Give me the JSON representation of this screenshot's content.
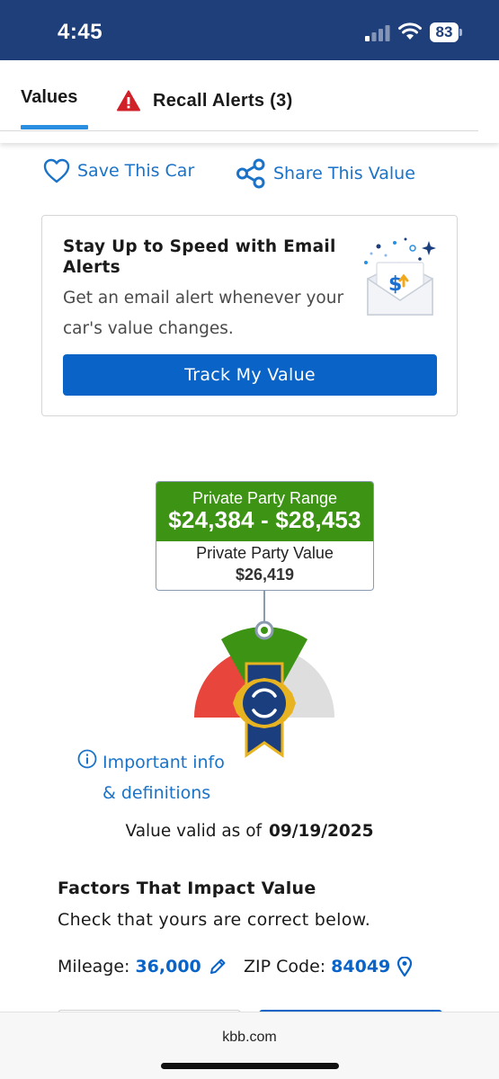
{
  "status_bar": {
    "time": "4:45",
    "battery": "83"
  },
  "tabs": {
    "values": "Values",
    "recall": "Recall Alerts (3)"
  },
  "actions": {
    "save": "Save This Car",
    "share": "Share This Value"
  },
  "email_alert": {
    "title": "Stay Up to Speed with Email Alerts",
    "description": "Get an email alert whenever your car's value changes.",
    "button": "Track My Value"
  },
  "valuation": {
    "range_label": "Private Party Range",
    "range_value": "$24,384 - $28,453",
    "value_label": "Private Party Value",
    "value": "$26,419"
  },
  "info_link": {
    "line1": "Important info",
    "line2": "& definitions"
  },
  "validity": {
    "label": "Value valid as of",
    "date": "09/19/2025"
  },
  "factors": {
    "title": "Factors That Impact Value",
    "subtitle": "Check that yours are correct below.",
    "mileage_label": "Mileage:",
    "mileage_value": "36,000",
    "zip_label": "ZIP Code:",
    "zip_value": "84049"
  },
  "browser": {
    "url": "kbb.com"
  },
  "colors": {
    "status_bar": "#1f3f7a",
    "link_blue": "#1a73c8",
    "button_blue": "#0a64c8",
    "range_green": "#3d9314",
    "gauge_red": "#e8453c",
    "gauge_gray": "#dedede",
    "badge_navy": "#1b3f7e",
    "badge_gold": "#e8b320"
  },
  "icons": [
    "signal-icon",
    "wifi-icon",
    "battery-icon",
    "warning-icon",
    "heart-icon",
    "share-icon",
    "email-alert-illustration",
    "kbb-badge-icon",
    "info-icon",
    "pencil-icon",
    "location-pin-icon"
  ]
}
